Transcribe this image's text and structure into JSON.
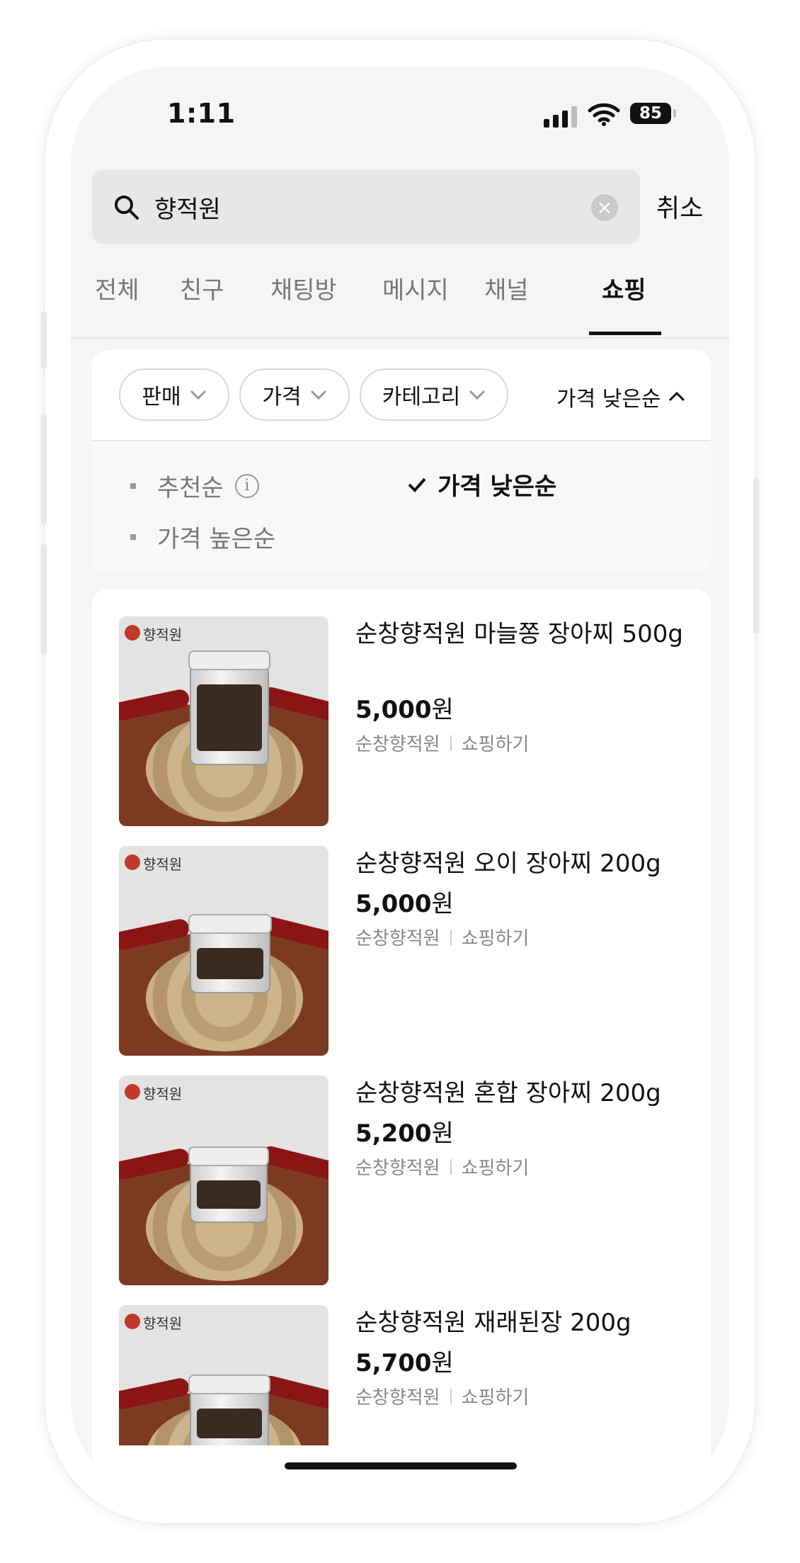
{
  "status_bar": {
    "time": "1:11",
    "battery": "85"
  },
  "search": {
    "query": "향적원",
    "cancel_label": "취소"
  },
  "tabs": [
    {
      "label": "전체"
    },
    {
      "label": "친구"
    },
    {
      "label": "채팅방"
    },
    {
      "label": "메시지"
    },
    {
      "label": "채널"
    },
    {
      "label": "쇼핑",
      "active": true
    }
  ],
  "filters": {
    "chips": [
      {
        "label": "판매"
      },
      {
        "label": "가격"
      },
      {
        "label": "카테고리"
      }
    ],
    "sort_current": "가격 낮은순",
    "sort_options": [
      {
        "label": "추천순"
      },
      {
        "label": "가격 낮은순",
        "selected": true
      },
      {
        "label": "가격 높은순"
      }
    ]
  },
  "products": [
    {
      "name": "순창향적원 마늘쫑 장아찌 500g",
      "price_number": "5,000",
      "price_unit": "원",
      "seller": "순창향적원",
      "action": "쇼핑하기"
    },
    {
      "name": "순창향적원 오이 장아찌 200g",
      "price_number": "5,000",
      "price_unit": "원",
      "seller": "순창향적원",
      "action": "쇼핑하기"
    },
    {
      "name": "순창향적원 혼합 장아찌 200g",
      "price_number": "5,200",
      "price_unit": "원",
      "seller": "순창향적원",
      "action": "쇼핑하기"
    },
    {
      "name": "순창향적원 재래된장 200g",
      "price_number": "5,700",
      "price_unit": "원",
      "seller": "순창향적원",
      "action": "쇼핑하기"
    }
  ],
  "image_brand_text": "향적원",
  "colors": {
    "active_tab_underline": "#111111",
    "background": "#f5f5f5",
    "card": "#ffffff"
  }
}
